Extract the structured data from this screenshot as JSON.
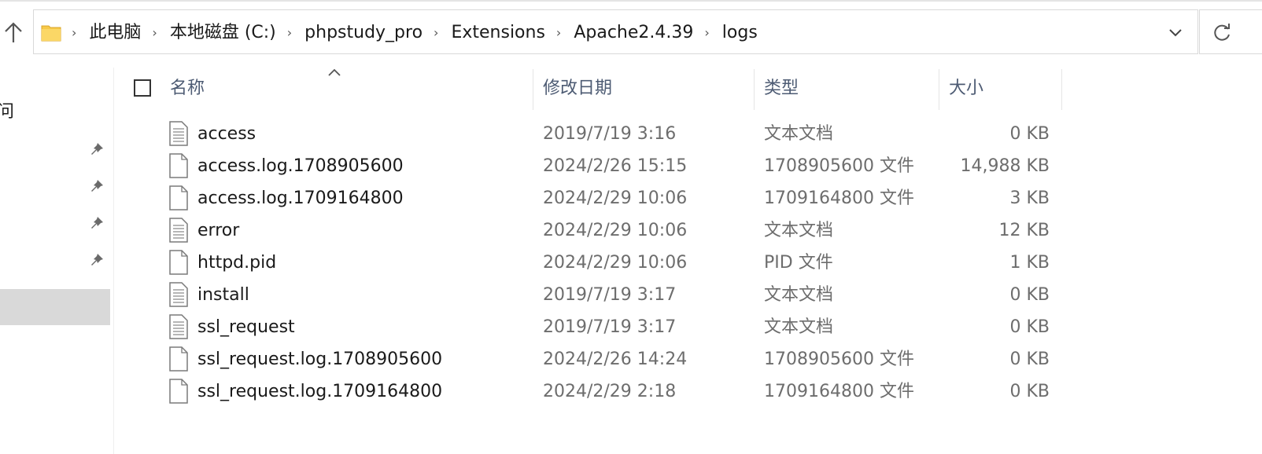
{
  "breadcrumb": [
    "此电脑",
    "本地磁盘 (C:)",
    "phpstudy_pro",
    "Extensions",
    "Apache2.4.39",
    "logs"
  ],
  "nav": {
    "partial_text": "问",
    "pinned_count": 4
  },
  "columns": {
    "name": "名称",
    "date": "修改日期",
    "type": "类型",
    "size": "大小"
  },
  "files": [
    {
      "name": "access",
      "date": "2019/7/19 3:16",
      "type": "文本文档",
      "size": "0 KB",
      "icon": "text-file-icon"
    },
    {
      "name": "access.log.1708905600",
      "date": "2024/2/26 15:15",
      "type": "1708905600 文件",
      "size": "14,988 KB",
      "icon": "file-icon"
    },
    {
      "name": "access.log.1709164800",
      "date": "2024/2/29 10:06",
      "type": "1709164800 文件",
      "size": "3 KB",
      "icon": "file-icon"
    },
    {
      "name": "error",
      "date": "2024/2/29 10:06",
      "type": "文本文档",
      "size": "12 KB",
      "icon": "text-file-icon"
    },
    {
      "name": "httpd.pid",
      "date": "2024/2/29 10:06",
      "type": "PID 文件",
      "size": "1 KB",
      "icon": "file-icon"
    },
    {
      "name": "install",
      "date": "2019/7/19 3:17",
      "type": "文本文档",
      "size": "0 KB",
      "icon": "text-file-icon"
    },
    {
      "name": "ssl_request",
      "date": "2019/7/19 3:17",
      "type": "文本文档",
      "size": "0 KB",
      "icon": "text-file-icon"
    },
    {
      "name": "ssl_request.log.1708905600",
      "date": "2024/2/26 14:24",
      "type": "1708905600 文件",
      "size": "0 KB",
      "icon": "file-icon"
    },
    {
      "name": "ssl_request.log.1709164800",
      "date": "2024/2/29 2:18",
      "type": "1709164800 文件",
      "size": "0 KB",
      "icon": "file-icon"
    }
  ],
  "colors": {
    "folder": "#f7c948",
    "header_text": "#4d5b73",
    "selection": "#d9d9d9",
    "muted_text": "#6d6d6d"
  }
}
